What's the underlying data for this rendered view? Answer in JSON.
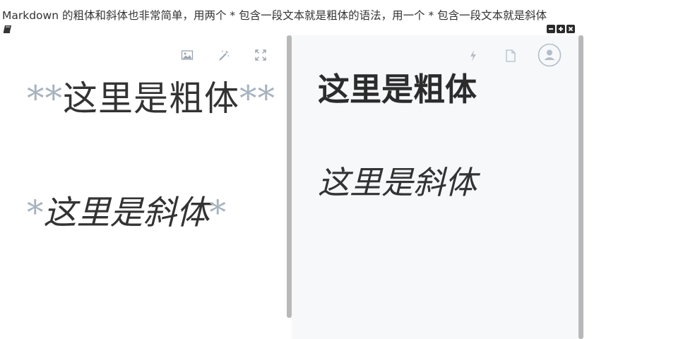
{
  "intro_text": "Markdown 的粗体和斜体也非常简单，用两个 * 包含一段文本就是粗体的语法，用一个 * 包含一段文本就是斜体",
  "editor": {
    "bold_marker": "**",
    "bold_text": "这里是粗体",
    "italic_marker": "*",
    "italic_text": "这里是斜体",
    "toolbar": [
      "image-icon",
      "magic-wand-icon",
      "fullscreen-icon"
    ]
  },
  "preview": {
    "bold_text": "这里是粗体",
    "italic_text": "这里是斜体",
    "toolbar": [
      "lightning-icon",
      "document-icon",
      "user-avatar-icon"
    ]
  },
  "window_controls": [
    "minimize-icon",
    "maximize-icon",
    "close-icon"
  ],
  "colors": {
    "markdown_marker": "#a7b3bf",
    "preview_background": "#f6f8fa",
    "divider": "#b8b8b8"
  }
}
